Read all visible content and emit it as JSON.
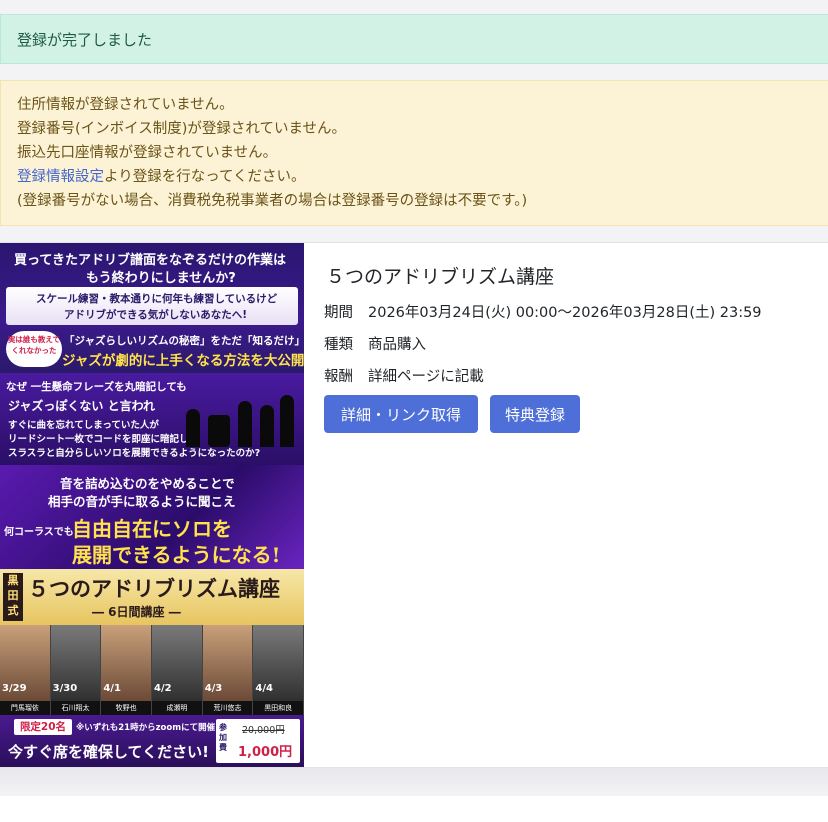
{
  "alerts": {
    "success": "登録が完了しました",
    "warning": {
      "line1": "住所情報が登録されていません。",
      "line2": "登録番号(インボイス制度)が登録されていません。",
      "line3": "振込先口座情報が登録されていません。",
      "link": "登録情報設定",
      "line4_suffix": "より登録を行なってください。",
      "line5": "(登録番号がない場合、消費税免税事業者の場合は登録番号の登録は不要です。)"
    }
  },
  "banner": {
    "headline1": "買ってきたアドリブ譜面をなぞるだけの作業は",
    "headline2": "もう終わりにしませんか?",
    "sub1": "スケール練習・教本通りに何年も練習しているけど",
    "sub2": "アドリブができる気がしないあなたへ!",
    "badge": "実は誰も教えてくれなかった",
    "hook1": "「ジャズらしいリズムの秘密」をただ「知るだけ」で",
    "hook2": "ジャズが劇的に上手くなる方法を大公開!",
    "why1": "なぜ 一生懸命フレーズを丸暗記しても",
    "why2": "ジャズっぽくない と言われ",
    "why3": "すぐに曲を忘れてしまっていた人が",
    "why4": "リードシート一枚でコードを即座に暗記し、",
    "why5": "スラスラと自分らしいソロを展開できるようになったのか?",
    "s3line1": "音を詰め込むのをやめることで",
    "s3line2": "相手の音が手に取るように聞こえ",
    "s3any": "何コーラスでも",
    "s3big1": "自由自在にソロを",
    "s3big2": "展開できるようになる!",
    "school": "黒田式",
    "course": "５つのアドリブリズム講座",
    "days": "― 6日間講座 ―",
    "dates": [
      "3/29",
      "3/30",
      "4/1",
      "4/2",
      "4/3",
      "4/4"
    ],
    "names": [
      "門馬瑠依",
      "石川翔太",
      "牧野也",
      "成瀬明",
      "荒川悠志",
      "黒田和良"
    ],
    "limit": "限定20名",
    "zoom": "※いずれも21時からzoomにて開催",
    "cta": "今すぐ席を確保してください!",
    "fee_label": "参加費",
    "price_old": "20,000円",
    "price_new": "1,000円"
  },
  "campaign": {
    "title": "５つのアドリブリズム講座",
    "period_label": "期間",
    "period_value": "2026年03月24日(火) 00:00〜2026年03月28日(土) 23:59",
    "type_label": "種類",
    "type_value": "商品購入",
    "reward_label": "報酬",
    "reward_value": "詳細ページに記載",
    "detail_button": "詳細・リンク取得",
    "benefit_button": "特典登録"
  },
  "colors": {
    "success_bg": "#d1f2e4",
    "warning_bg": "#fcf3d7",
    "primary": "#4f6fd8",
    "link": "#4466cc"
  }
}
